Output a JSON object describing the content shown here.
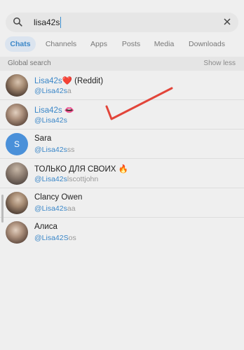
{
  "search": {
    "query": "lisa42s"
  },
  "tabs": [
    {
      "label": "Chats",
      "active": true
    },
    {
      "label": "Channels",
      "active": false
    },
    {
      "label": "Apps",
      "active": false
    },
    {
      "label": "Posts",
      "active": false
    },
    {
      "label": "Media",
      "active": false
    },
    {
      "label": "Downloads",
      "active": false
    }
  ],
  "section": {
    "title": "Global search",
    "action": "Show less"
  },
  "results": [
    {
      "name_hl": "Lisa42s",
      "name_rest": "❤️ (Reddit)",
      "handle_hl": "@Lisa42s",
      "handle_rest": "a",
      "avatar": "photo"
    },
    {
      "name_hl": "Lisa42s",
      "name_rest": " 👄",
      "handle_hl": "@Lisa42s",
      "handle_rest": "",
      "avatar": "photo2"
    },
    {
      "name_hl": "",
      "name_rest": "Sara",
      "handle_hl": "@Lisa42s",
      "handle_rest": "ss",
      "avatar": "letter",
      "avatar_letter": "S"
    },
    {
      "name_hl": "",
      "name_rest": "ТОЛЬКО ДЛЯ СВОИХ 🔥",
      "handle_hl": "@Lisa42s",
      "handle_rest": "lscottjohn",
      "avatar": "photo3"
    },
    {
      "name_hl": "",
      "name_rest": "Clancy Owen",
      "handle_hl": "@Lisa42s",
      "handle_rest": "aa",
      "avatar": "photo"
    },
    {
      "name_hl": "",
      "name_rest": "Алиса",
      "handle_hl": "@Lisa42S",
      "handle_rest": "os",
      "avatar": "photo2"
    }
  ],
  "colors": {
    "accent": "#3b87c8",
    "annotation": "#e2453a"
  }
}
